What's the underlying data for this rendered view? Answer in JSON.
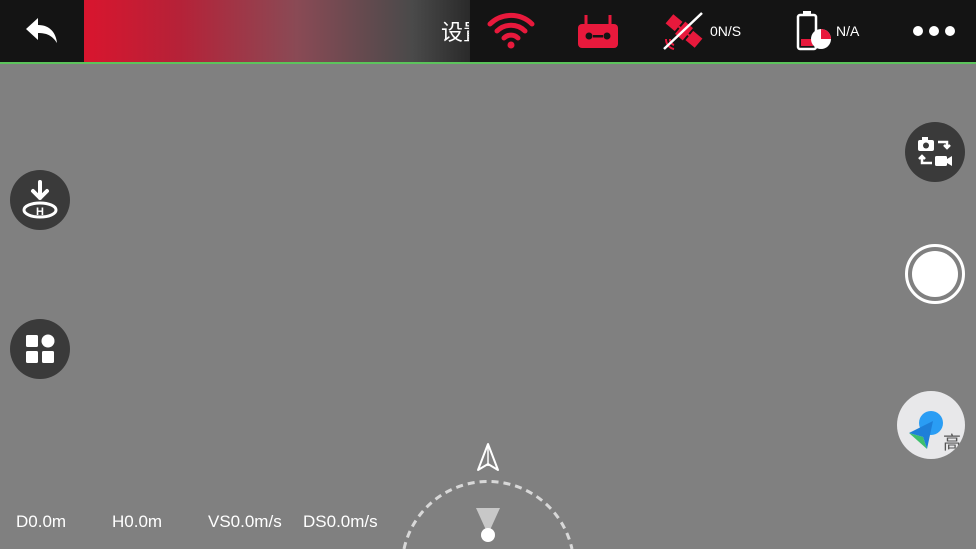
{
  "header": {
    "title": "设置",
    "gps": "0N/S",
    "battery": "N/A"
  },
  "icons": {
    "back": "back-arrow-icon",
    "wifi": "wifi-icon",
    "remote": "remote-controller-icon",
    "satellite": "satellite-icon",
    "battery": "battery-icon",
    "more": "more-dots-icon",
    "takeoff": "takeoff-landing-icon",
    "modes": "flight-modes-icon",
    "camera_switch": "camera-switch-icon",
    "shutter": "shutter-icon",
    "map": "map-navigation-icon"
  },
  "colors": {
    "alert_red": "#e8193c",
    "topbar": "#141414",
    "background": "#808080",
    "status_line": "#5cc35c"
  },
  "map": {
    "label": "高"
  },
  "telemetry": {
    "distance": "D0.0m",
    "height": "H0.0m",
    "vertical_speed": "VS0.0m/s",
    "distance_speed": "DS0.0m/s"
  }
}
